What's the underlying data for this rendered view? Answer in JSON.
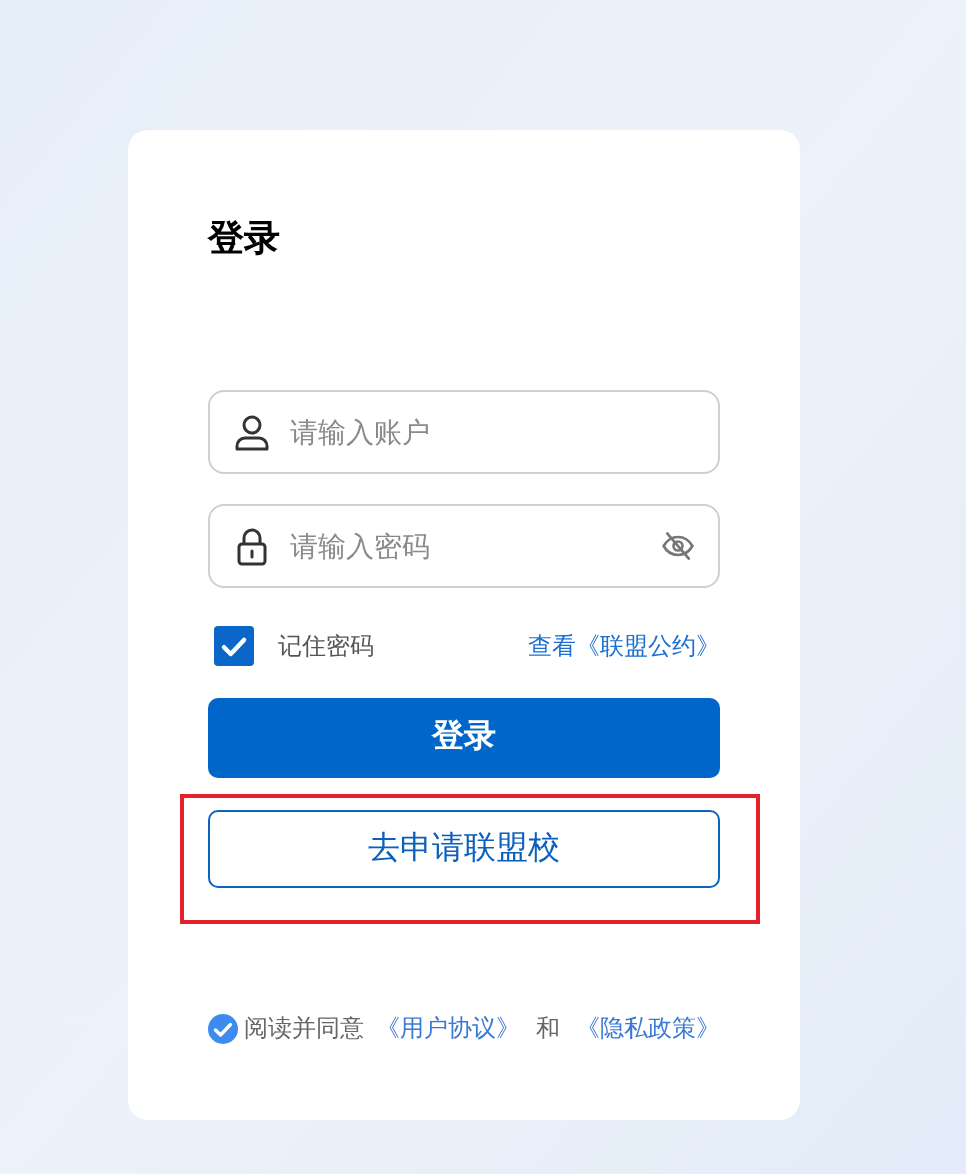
{
  "title": "登录",
  "account_field": {
    "placeholder": "请输入账户"
  },
  "password_field": {
    "placeholder": "请输入密码"
  },
  "remember": {
    "label": "记住密码",
    "checked": true
  },
  "convention_link": "查看《联盟公约》",
  "login_button": "登录",
  "apply_button": {
    "label": "去申请联盟校",
    "highlighted": true
  },
  "agreement": {
    "checked": true,
    "prefix": "阅读并同意",
    "user_agreement": "《用户协议》",
    "and": "和",
    "privacy_policy": "《隐私政策》"
  }
}
